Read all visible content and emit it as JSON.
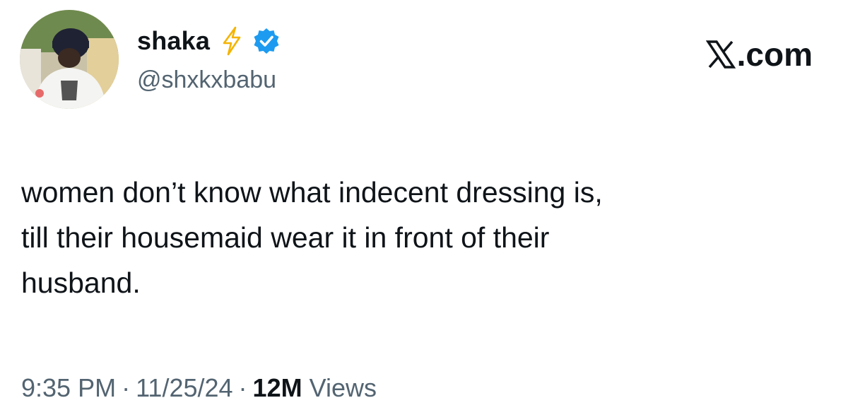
{
  "user": {
    "display_name": "shaka",
    "handle": "@shxkxbabu",
    "avatar": "avatar-photo",
    "emoji": "lightning-bolt-icon",
    "verified": "verified-badge-icon"
  },
  "brand": {
    "label": ".com",
    "logo": "x-logo-icon"
  },
  "tweet": {
    "lines": [
      "women don’t know what indecent dressing is,",
      "till their housemaid wear it in front of their",
      "husband."
    ]
  },
  "meta": {
    "time": "9:35 PM",
    "separator": "·",
    "date": "11/25/24",
    "views_count": "12M",
    "views_label": "Views"
  },
  "colors": {
    "text": "#0f1419",
    "secondary": "#536471",
    "verified": "#1d9bf0",
    "bolt": "#f4b400"
  }
}
